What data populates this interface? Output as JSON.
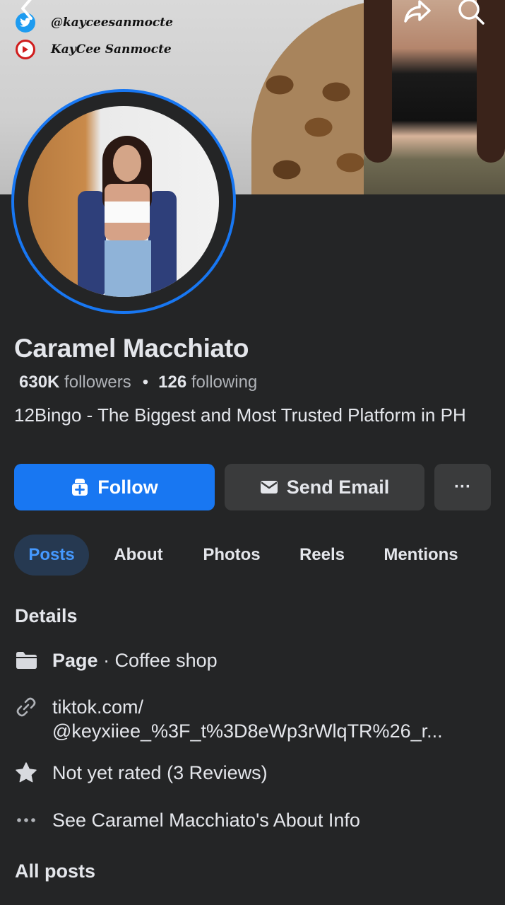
{
  "cover": {
    "twitter_handle": "@kayceesanmocte",
    "youtube_name": "KayCee Sanmocte"
  },
  "profile": {
    "name": "Caramel Macchiato",
    "followers_count": "630K",
    "followers_label": "followers",
    "following_count": "126",
    "following_label": "following",
    "bio": "12Bingo - The Biggest and Most Trusted Platform in PH"
  },
  "actions": {
    "follow_label": "Follow",
    "email_label": "Send Email",
    "more_label": "···"
  },
  "tabs": [
    {
      "label": "Posts",
      "active": true
    },
    {
      "label": "About"
    },
    {
      "label": "Photos"
    },
    {
      "label": "Reels"
    },
    {
      "label": "Mentions"
    }
  ],
  "details": {
    "heading": "Details",
    "page_type_label": "Page",
    "category": "· Coffee shop",
    "link_line1": "tiktok.com/",
    "link_line2": "@keyxiiee_%3F_t%3D8eWp3rWlqTR%26_r...",
    "rating": "Not yet rated (3 Reviews)",
    "about_info": "See Caramel Macchiato's About Info"
  },
  "all_posts_heading": "All posts",
  "colors": {
    "background": "#242526",
    "accent": "#1877f2",
    "link": "#4599ff",
    "button_secondary": "#3a3b3c"
  }
}
